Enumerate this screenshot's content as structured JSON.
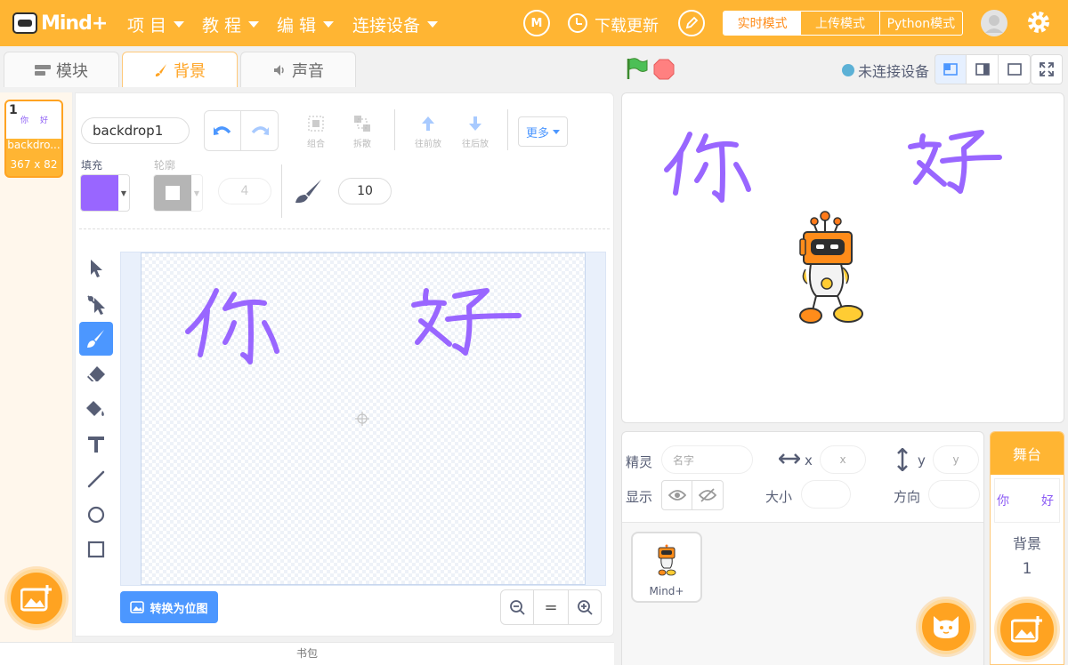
{
  "app": {
    "logo_text": "Mind+"
  },
  "menu": {
    "items": [
      {
        "label": "项 目"
      },
      {
        "label": "教 程"
      },
      {
        "label": "编 辑"
      },
      {
        "label": "连接设备"
      }
    ],
    "update_label": "下载更新",
    "modes": [
      {
        "label": "实时模式",
        "active": true
      },
      {
        "label": "上传模式",
        "active": false
      },
      {
        "label": "Python模式",
        "active": false
      }
    ]
  },
  "tabs": [
    {
      "label": "模块",
      "active": false
    },
    {
      "label": "背景",
      "active": true
    },
    {
      "label": "声音",
      "active": false
    }
  ],
  "backdrop_list": {
    "items": [
      {
        "index": "1",
        "name": "backdro...",
        "size": "367 x 82",
        "preview_left": "你",
        "preview_right": "好"
      }
    ]
  },
  "editor": {
    "name_value": "backdrop1",
    "group_label": "组合",
    "ungroup_label": "拆散",
    "forward_label": "往前放",
    "backward_label": "往后放",
    "more_label": "更多",
    "fill_label": "填充",
    "outline_label": "轮廓",
    "fill_color": "#9966ff",
    "outline_color": "#b5b5b5",
    "outline_width": "4",
    "brush_size": "10",
    "convert_label": "转换为位图",
    "zoom_reset_label": "="
  },
  "bag_label": "书包",
  "stage_header": {
    "connection_label": "未连接设备"
  },
  "sprite_info": {
    "sprite_label": "精灵",
    "name_placeholder": "名字",
    "x_label": "x",
    "x_placeholder": "x",
    "y_label": "y",
    "y_placeholder": "y",
    "show_label": "显示",
    "size_label": "大小",
    "direction_label": "方向",
    "sprites": [
      {
        "name": "Mind+"
      }
    ]
  },
  "stage_panel": {
    "title": "舞台",
    "preview_left": "你",
    "preview_right": "好",
    "backdrop_label": "背景",
    "backdrop_count": "1"
  },
  "colors": {
    "brand": "#ffb533",
    "accent_blue": "#4c97ff",
    "paint_purple": "#9966ff"
  }
}
